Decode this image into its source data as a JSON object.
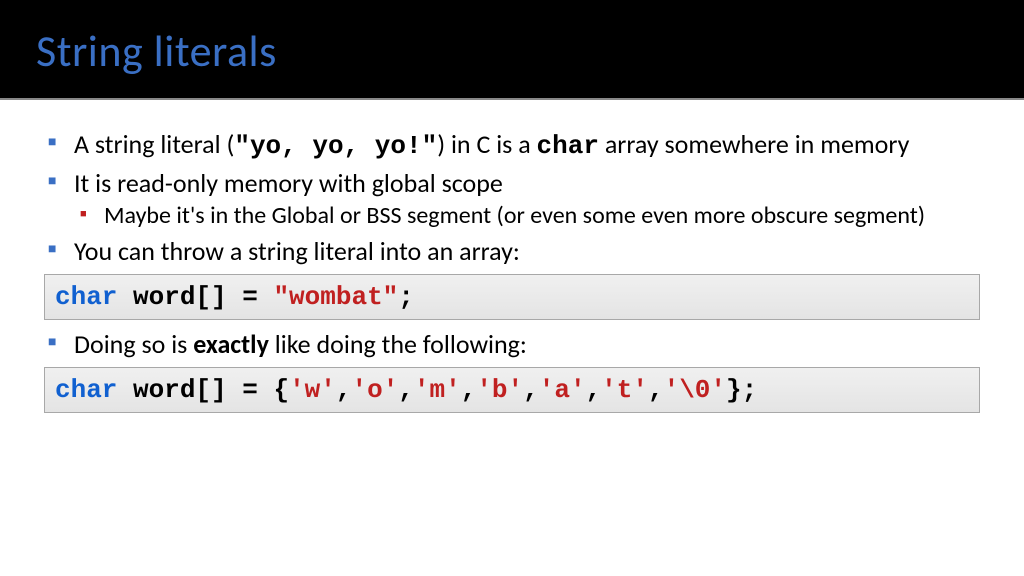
{
  "header": {
    "title": "String literals"
  },
  "bullets": {
    "b1_pre": "A string literal (",
    "b1_code": "\"yo, yo, yo!\"",
    "b1_mid": ") in C is a ",
    "b1_char": "char",
    "b1_post": " array somewhere in memory",
    "b2": "It is read-only memory with global scope",
    "b2_sub": "Maybe it's in the Global or BSS segment (or even some even more obscure segment)",
    "b3": "You can throw a string literal into an array:",
    "b4_pre": "Doing so is ",
    "b4_bold": "exactly",
    "b4_post": " like doing the following:"
  },
  "code1": {
    "kw": "char",
    "decl": " word[] = ",
    "str": "\"wombat\"",
    "end": ";"
  },
  "code2": {
    "kw": "char",
    "decl": " word[] = {",
    "c0": "'w'",
    "c1": "'o'",
    "c2": "'m'",
    "c3": "'b'",
    "c4": "'a'",
    "c5": "'t'",
    "c6": "'\\0'",
    "sep": ",",
    "end": "};"
  }
}
